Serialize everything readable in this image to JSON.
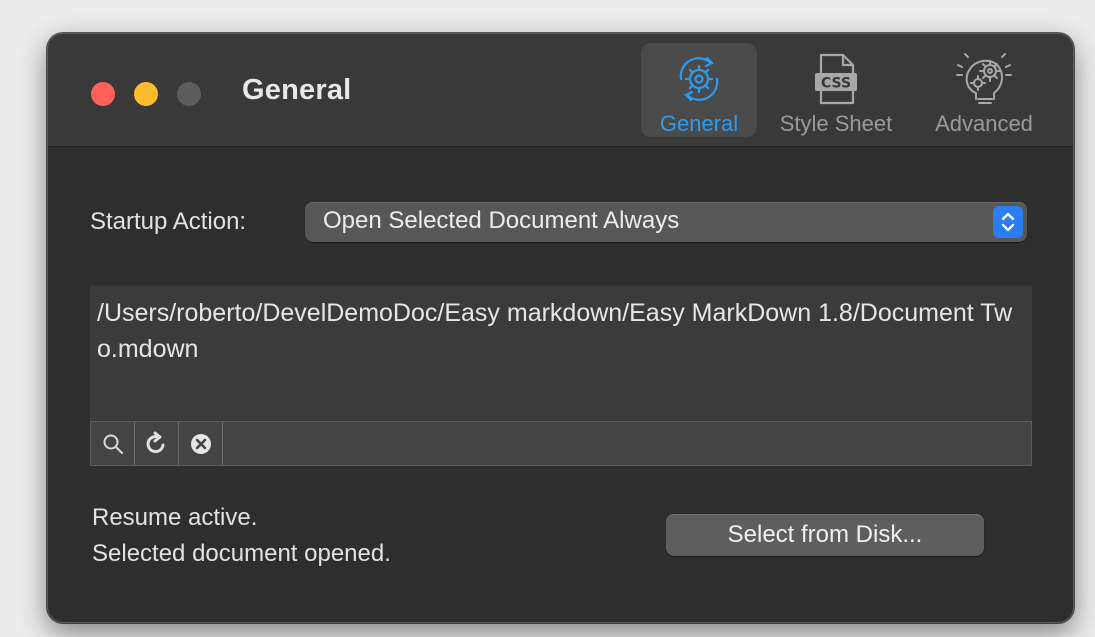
{
  "window": {
    "title": "General"
  },
  "toolbar": {
    "items": [
      {
        "label": "General",
        "icon": "gear-sync-icon",
        "selected": true
      },
      {
        "label": "Style Sheet",
        "icon": "css-file-icon",
        "selected": false
      },
      {
        "label": "Advanced",
        "icon": "brain-gears-icon",
        "selected": false
      }
    ]
  },
  "startup": {
    "label": "Startup Action:",
    "selected_value": "Open Selected Document Always"
  },
  "path_control": {
    "value": "/Users/roberto/DevelDemoDoc/Easy markdown/Easy MarkDown 1.8/Document Two.mdown",
    "buttons": [
      {
        "icon": "magnifier-icon"
      },
      {
        "icon": "reload-icon"
      },
      {
        "icon": "clear-icon"
      }
    ]
  },
  "status": {
    "line1": "Resume active.",
    "line2": "Selected document opened."
  },
  "select_button": {
    "label": "Select from Disk..."
  },
  "colors": {
    "accent": "#2d9cf0",
    "close": "#fe5f57",
    "minimize": "#febc2e",
    "zoom_disabled": "#5d5d5d"
  }
}
